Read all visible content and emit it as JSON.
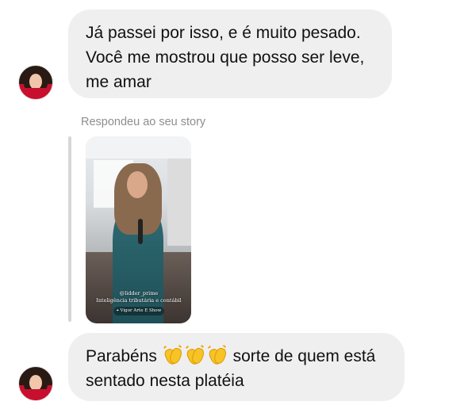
{
  "messages": [
    {
      "lines": [
        "Já passei por isso, e é muito pesado.",
        "Você me mostrou que posso ser leve,",
        "me amar"
      ]
    },
    {
      "reply_label": "Respondeu ao seu story",
      "story_caption": {
        "handle": "@lidder_prime",
        "text": "Inteligência tributária e contábil",
        "location": "Vigor Arte E Show"
      }
    },
    {
      "text_before": "Parabéns",
      "emojis": [
        "clap-icon",
        "clap-icon",
        "clap-icon"
      ],
      "text_after": "sorte de quem está",
      "line2": "sentado nesta platéia"
    }
  ],
  "colors": {
    "bubble_bg": "#efefef",
    "reply_label": "#8e8e8e",
    "reply_bar": "#d7d7d7"
  }
}
